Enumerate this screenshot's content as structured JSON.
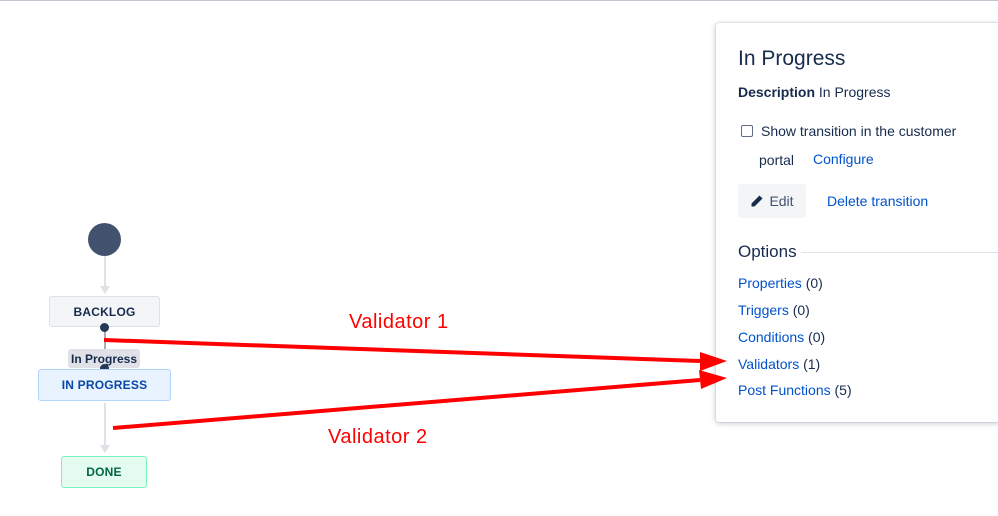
{
  "diagram": {
    "statuses": {
      "backlog": "BACKLOG",
      "in_progress": "IN PROGRESS",
      "done": "DONE"
    },
    "transition_label": "In Progress"
  },
  "annotations": {
    "color": "#ff0000",
    "validator_1": "Validator 1",
    "validator_2": "Validator 2"
  },
  "panel": {
    "title": "In Progress",
    "description_label": "Description",
    "description_value": "In Progress",
    "checkbox": {
      "label_line1": "Show transition in the customer",
      "label_line2": "portal",
      "checked": false
    },
    "configure_link": "Configure",
    "edit_button": "Edit",
    "delete_link": "Delete transition",
    "options_title": "Options",
    "options": [
      {
        "label": "Properties",
        "count": "(0)"
      },
      {
        "label": "Triggers",
        "count": "(0)"
      },
      {
        "label": "Conditions",
        "count": "(0)"
      },
      {
        "label": "Validators",
        "count": "(1)"
      },
      {
        "label": "Post Functions",
        "count": "(5)"
      }
    ]
  },
  "colors": {
    "link": "#0052cc",
    "text": "#172b4d",
    "start_node": "#42526e"
  }
}
